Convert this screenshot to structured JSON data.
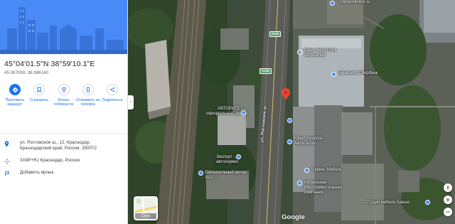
{
  "place": {
    "coordinates_dms": "45°04'01.5\"N 38°59'10.1\"E",
    "coordinates_decimal": "45.067090, 38.986140"
  },
  "actions": [
    {
      "label": "Проложить маршрут",
      "icon": "directions-icon"
    },
    {
      "label": "Сохранить",
      "icon": "bookmark-icon"
    },
    {
      "label": "Искать поблизости",
      "icon": "nearby-icon"
    },
    {
      "label": "Отправить на телефон",
      "icon": "phone-icon"
    },
    {
      "label": "Поделиться",
      "icon": "share-icon"
    }
  ],
  "details": {
    "address": "ул. Ростовское ш., 12, Краснодар, Краснодарский край, Россия, 350072",
    "plus_code": "3X8P+RJ Краснодар, Россия",
    "add_label": "Добавить ярлык"
  },
  "map": {
    "street": "ул. Ростовское ш.",
    "road_shields": [
      "E115",
      "A136"
    ],
    "labels": {
      "okrasovskoe": "Окрасовское ш.",
      "avto": "Юнит Авто Ford\nАвтосалон",
      "sber": "Банкомат Сбербанк",
      "avtor": "АВТОРИТЕТ ...\nофициальный дилер\n...",
      "hyundai": "Юнит Hyundai\nАвтосалон",
      "expert": "Эксперт ...\nавтосервис",
      "uaz": "Официальный дилер\nУАЗ ...",
      "ufs": "Юфикс Мебель",
      "furn": "Мебельная\nИнструментальная\nкомпания",
      "studio": "Студия мебели Бакше"
    },
    "layer_label": "Слои",
    "watermark": "Google",
    "collapse_glyph": "‹"
  },
  "colors": {
    "accent": "#1a73e8",
    "pin": "#ea4335",
    "hero": "#4285f4"
  }
}
